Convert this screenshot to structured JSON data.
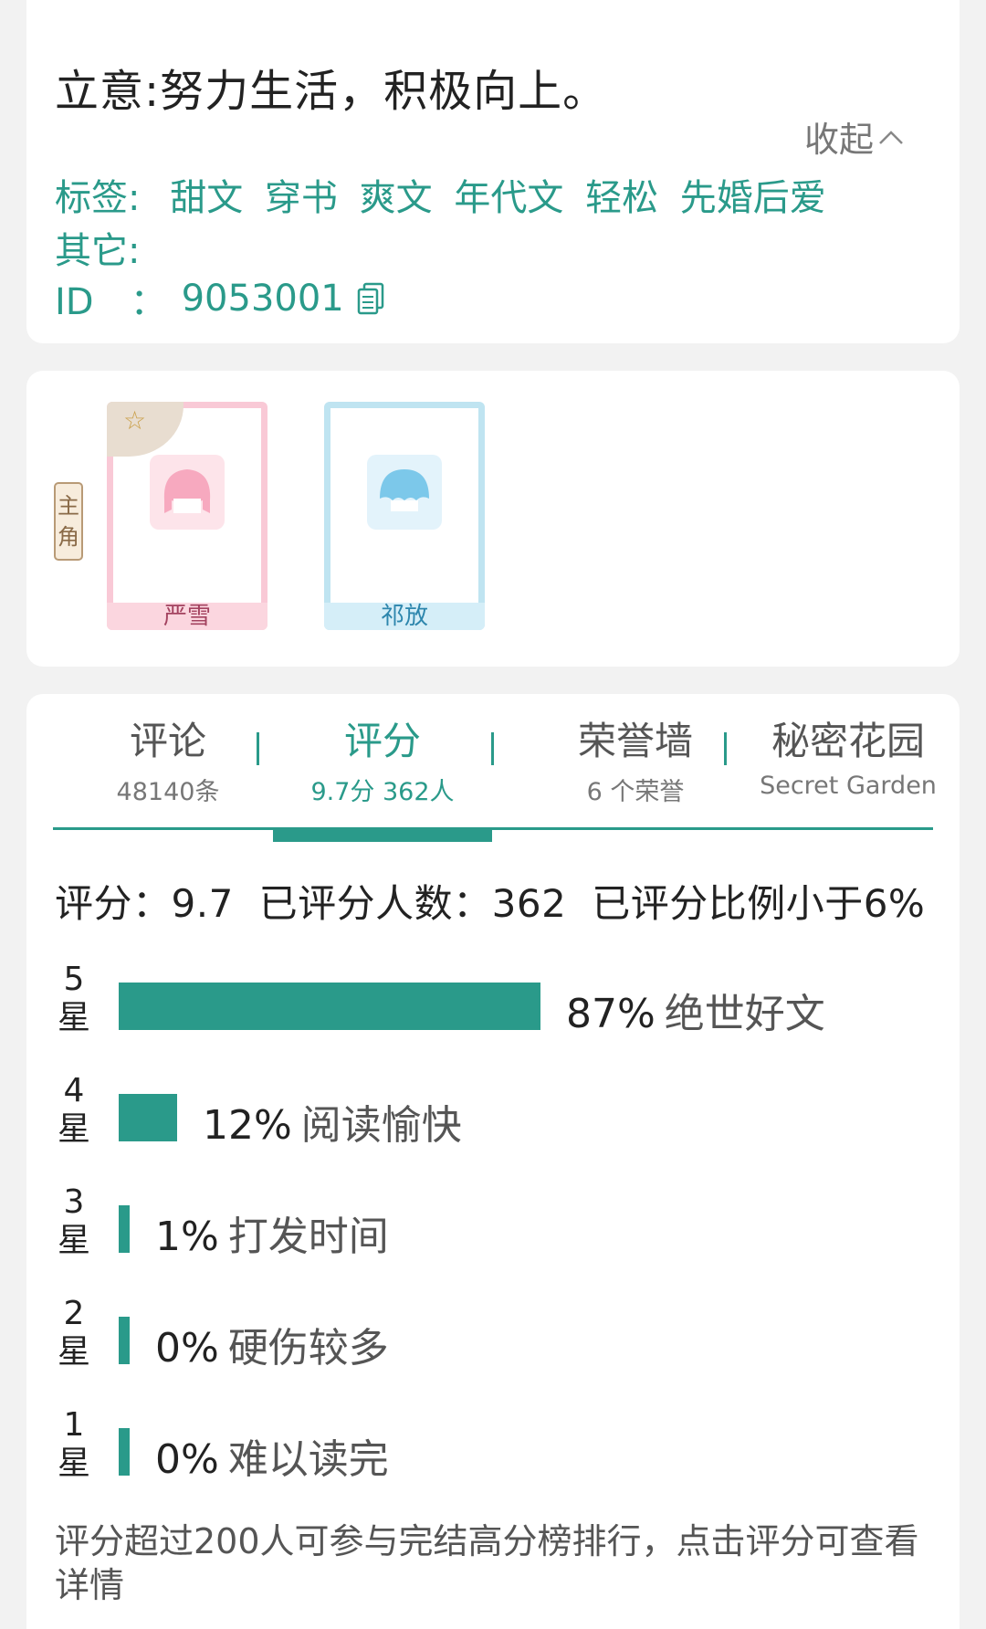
{
  "info": {
    "motto": "立意:努力生活，积极向上。",
    "collapse_label": "收起",
    "tags_label": "标签:",
    "tags": [
      "甜文",
      "穿书",
      "爽文",
      "年代文",
      "轻松",
      "先婚后爱"
    ],
    "other_label": "其它:",
    "id_label": "ID　：",
    "id_value": "9053001"
  },
  "roles": {
    "lead_badge": [
      "主",
      "角"
    ],
    "characters": [
      {
        "name": "严雪",
        "lead": true
      },
      {
        "name": "祁放",
        "lead": false
      }
    ]
  },
  "tabs": [
    {
      "label": "评论",
      "sub": "48140条",
      "active": false
    },
    {
      "label": "评分",
      "sub": "9.7分 362人",
      "active": true
    },
    {
      "label": "荣誉墙",
      "sub": "6 个荣誉",
      "active": false
    },
    {
      "label": "秘密花园",
      "sub": "Secret Garden",
      "active": false
    }
  ],
  "rating": {
    "summary": {
      "score": "评分：9.7",
      "count": "已评分人数：362",
      "ratio": "已评分比例小于6%"
    },
    "rows": [
      {
        "star": "5",
        "unit": "星",
        "percent": 87,
        "percent_label": "87%",
        "desc": "绝世好文"
      },
      {
        "star": "4",
        "unit": "星",
        "percent": 12,
        "percent_label": "12%",
        "desc": "阅读愉快"
      },
      {
        "star": "3",
        "unit": "星",
        "percent": 1,
        "percent_label": "1%",
        "desc": "打发时间"
      },
      {
        "star": "2",
        "unit": "星",
        "percent": 0,
        "percent_label": "0%",
        "desc": "硬伤较多"
      },
      {
        "star": "1",
        "unit": "星",
        "percent": 0,
        "percent_label": "0%",
        "desc": "难以读完"
      }
    ],
    "footnote": "评分超过200人可参与完结高分榜排行，点击评分可查看详情"
  },
  "colors": {
    "accent": "#2a9a8a",
    "lead_card": "#f9c9d6",
    "second_card": "#bfe4f1"
  }
}
